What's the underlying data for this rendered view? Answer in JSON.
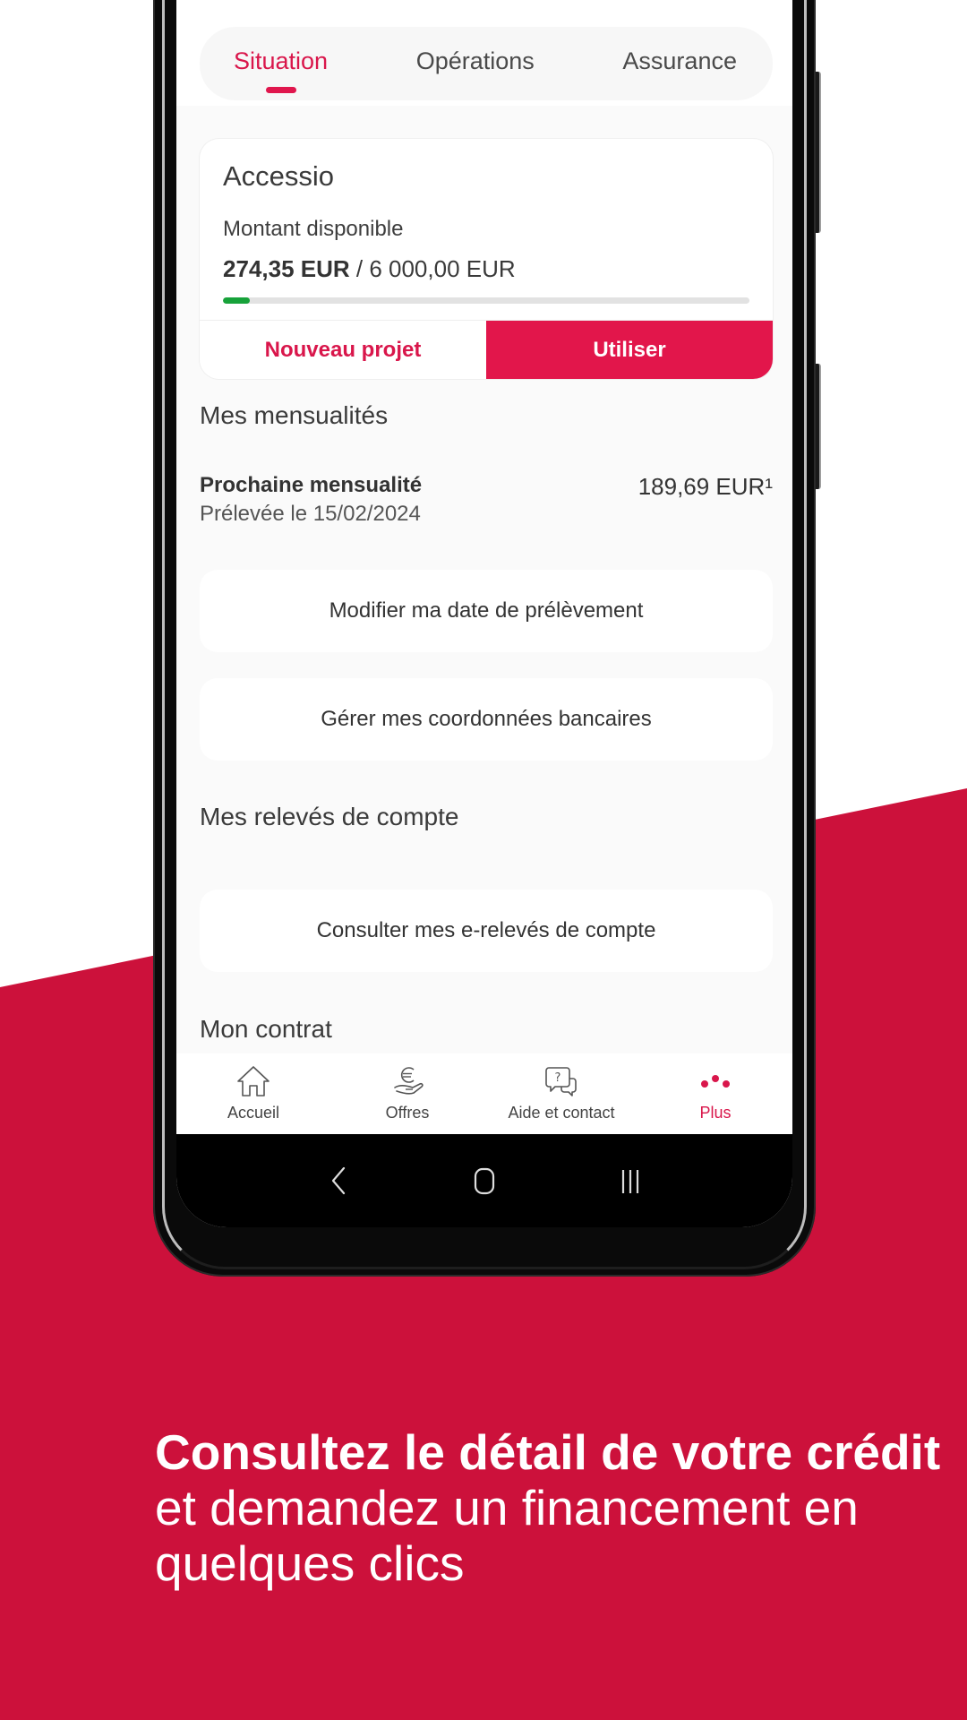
{
  "colors": {
    "brand_red": "#cc113b",
    "accent": "#e2164b",
    "progress_fill": "#17a23a",
    "progress_track": "#e2e2e2"
  },
  "tabs": [
    {
      "label": "Situation",
      "active": true
    },
    {
      "label": "Opérations",
      "active": false
    },
    {
      "label": "Assurance",
      "active": false
    }
  ],
  "credit_card": {
    "title": "Accessio",
    "available_label": "Montant disponible",
    "available_amount": "274,35 EUR",
    "separator": " / ",
    "total_amount": "6 000,00 EUR",
    "progress_percent": 4.57,
    "secondary_button": "Nouveau projet",
    "primary_button": "Utiliser"
  },
  "monthly": {
    "section_title": "Mes mensualités",
    "next_label": "Prochaine mensualité",
    "next_date": "Prélevée le 15/02/2024",
    "next_amount": "189,69 EUR¹",
    "actions": [
      "Modifier ma date de prélèvement",
      "Gérer mes coordonnées bancaires"
    ]
  },
  "statements": {
    "section_title": "Mes relevés de compte",
    "action": "Consulter mes e-relevés de compte"
  },
  "contract": {
    "section_title": "Mon contrat"
  },
  "bottom_nav": [
    {
      "label": "Accueil",
      "icon": "home-icon",
      "active": false
    },
    {
      "label": "Offres",
      "icon": "euro-hand-icon",
      "active": false
    },
    {
      "label": "Aide et contact",
      "icon": "help-chat-icon",
      "active": false
    },
    {
      "label": "Plus",
      "icon": "more-dots-icon",
      "active": true
    }
  ],
  "system_nav": [
    "back-icon",
    "home-circle-icon",
    "recents-icon"
  ],
  "headline": {
    "bold_part": "Consultez le détail de votre crédit",
    "regular_part": " et demandez un financement en quelques clics"
  }
}
